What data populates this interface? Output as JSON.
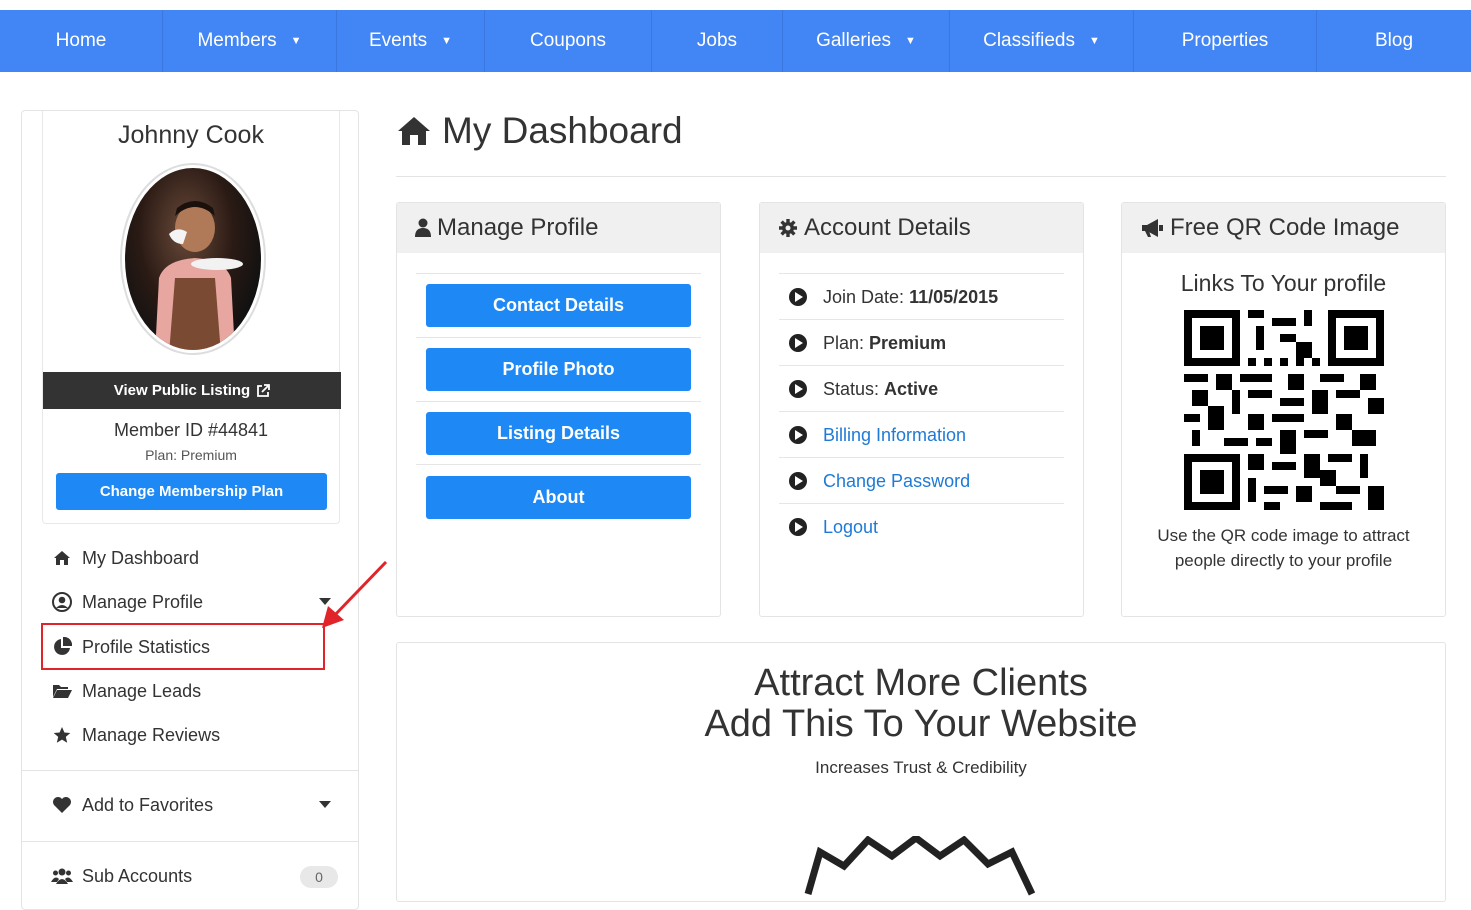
{
  "nav": {
    "items": [
      {
        "label": "Home",
        "caret": false
      },
      {
        "label": "Members",
        "caret": true
      },
      {
        "label": "Events",
        "caret": true
      },
      {
        "label": "Coupons",
        "caret": false
      },
      {
        "label": "Jobs",
        "caret": false
      },
      {
        "label": "Galleries",
        "caret": true
      },
      {
        "label": "Classifieds",
        "caret": true
      },
      {
        "label": "Properties",
        "caret": false
      },
      {
        "label": "Blog",
        "caret": false
      }
    ],
    "caret_glyph": "▼"
  },
  "profile": {
    "name": "Johnny Cook",
    "view_public_label": "View Public Listing",
    "member_id": "Member ID #44841",
    "plan": "Plan: Premium",
    "change_plan_label": "Change Membership Plan"
  },
  "sidebar": {
    "items": [
      {
        "label": "My Dashboard",
        "icon": "home-icon"
      },
      {
        "label": "Manage Profile",
        "icon": "user-circle-icon",
        "expandable": true
      },
      {
        "label": "Profile Statistics",
        "icon": "pie-chart-icon",
        "highlighted": true
      },
      {
        "label": "Manage Leads",
        "icon": "folder-open-icon"
      },
      {
        "label": "Manage Reviews",
        "icon": "star-icon"
      }
    ],
    "favorites_label": "Add to Favorites",
    "sub_accounts_label": "Sub Accounts",
    "sub_accounts_count": "0",
    "highlight_color": "#e0242a"
  },
  "main": {
    "title": "My Dashboard",
    "manage_profile": {
      "heading": "Manage Profile",
      "buttons": [
        "Contact Details",
        "Profile Photo",
        "Listing Details",
        "About"
      ]
    },
    "account_details": {
      "heading": "Account Details",
      "join_label": "Join Date:",
      "join_value": "11/05/2015",
      "plan_label": "Plan:",
      "plan_value": "Premium",
      "status_label": "Status:",
      "status_value": "Active",
      "links": [
        "Billing Information",
        "Change Password",
        "Logout"
      ]
    },
    "qr": {
      "heading": "Free QR Code Image",
      "title": "Links To Your profile",
      "caption_line1": "Use the QR code image to attract",
      "caption_line2": "people directly to your profile"
    },
    "attract": {
      "line1": "Attract More Clients",
      "line2": "Add This To Your Website",
      "subtitle": "Increases Trust & Credibility"
    }
  },
  "colors": {
    "nav_bg": "#4285f4",
    "button_blue": "#1e88f5",
    "link_blue": "#1e7ad6",
    "dark_button": "#333333"
  }
}
